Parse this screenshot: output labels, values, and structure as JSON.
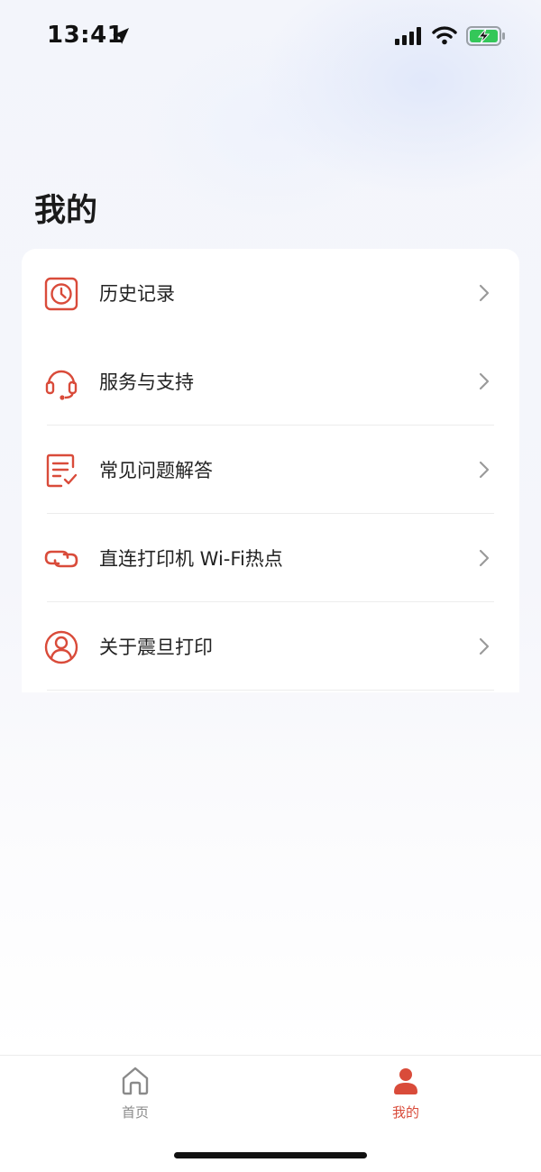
{
  "status_bar": {
    "time": "13:41"
  },
  "page": {
    "title": "我的"
  },
  "menu": {
    "items": [
      {
        "label": "历史记录",
        "icon": "history-clock-icon"
      },
      {
        "label": "服务与支持",
        "icon": "headset-icon"
      },
      {
        "label": "常见问题解答",
        "icon": "faq-checklist-icon"
      },
      {
        "label": "直连打印机 Wi-Fi热点",
        "icon": "link-icon"
      },
      {
        "label": "关于震旦打印",
        "icon": "user-circle-icon"
      }
    ]
  },
  "tab_bar": {
    "tabs": [
      {
        "label": "首页",
        "icon": "home-icon",
        "active": false
      },
      {
        "label": "我的",
        "icon": "person-icon",
        "active": true
      }
    ]
  },
  "colors": {
    "accent": "#d94b3a",
    "text": "#222222",
    "inactive": "#8a8a8a"
  }
}
